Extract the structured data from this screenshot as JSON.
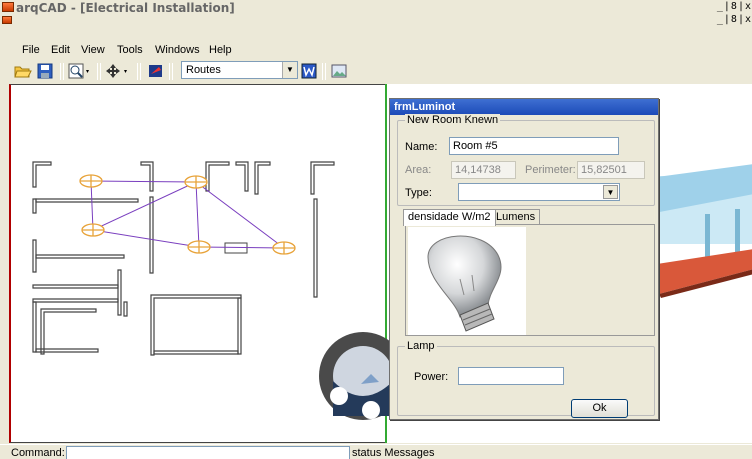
{
  "window": {
    "title": "arqCAD - [Electrical Installation]",
    "controls": "_|8|x"
  },
  "menu": [
    "File",
    "Edit",
    "View",
    "Tools",
    "Windows",
    "Help"
  ],
  "toolbar": {
    "routes_combo": "Routes",
    "icons": [
      "open-folder-icon",
      "save-icon",
      "zoom-icon",
      "pan-icon",
      "layers-icon",
      "word-icon",
      "image-icon"
    ]
  },
  "dialog": {
    "title": "frmLuminot",
    "group_title": "New Room Knewn",
    "name_label": "Name:",
    "name_value": "Room #5",
    "area_label": "Area:",
    "area_value": "14,14738",
    "perimeter_label": "Perimeter:",
    "perimeter_value": "15,82501",
    "type_label": "Type:",
    "type_value": "",
    "tabs": [
      "densidade W/m2",
      "Lumens"
    ],
    "lamp_group": "Lamp",
    "power_label": "Power:",
    "power_value": "",
    "ok_label": "Ok"
  },
  "status": {
    "command_label": "Command:",
    "command_value": "",
    "messages": "status Messages"
  },
  "colors": {
    "luminaire": "#e8a33a",
    "route": "#7a3fbf",
    "wall": "#444444",
    "dialog_title": "#2a5ac8"
  }
}
